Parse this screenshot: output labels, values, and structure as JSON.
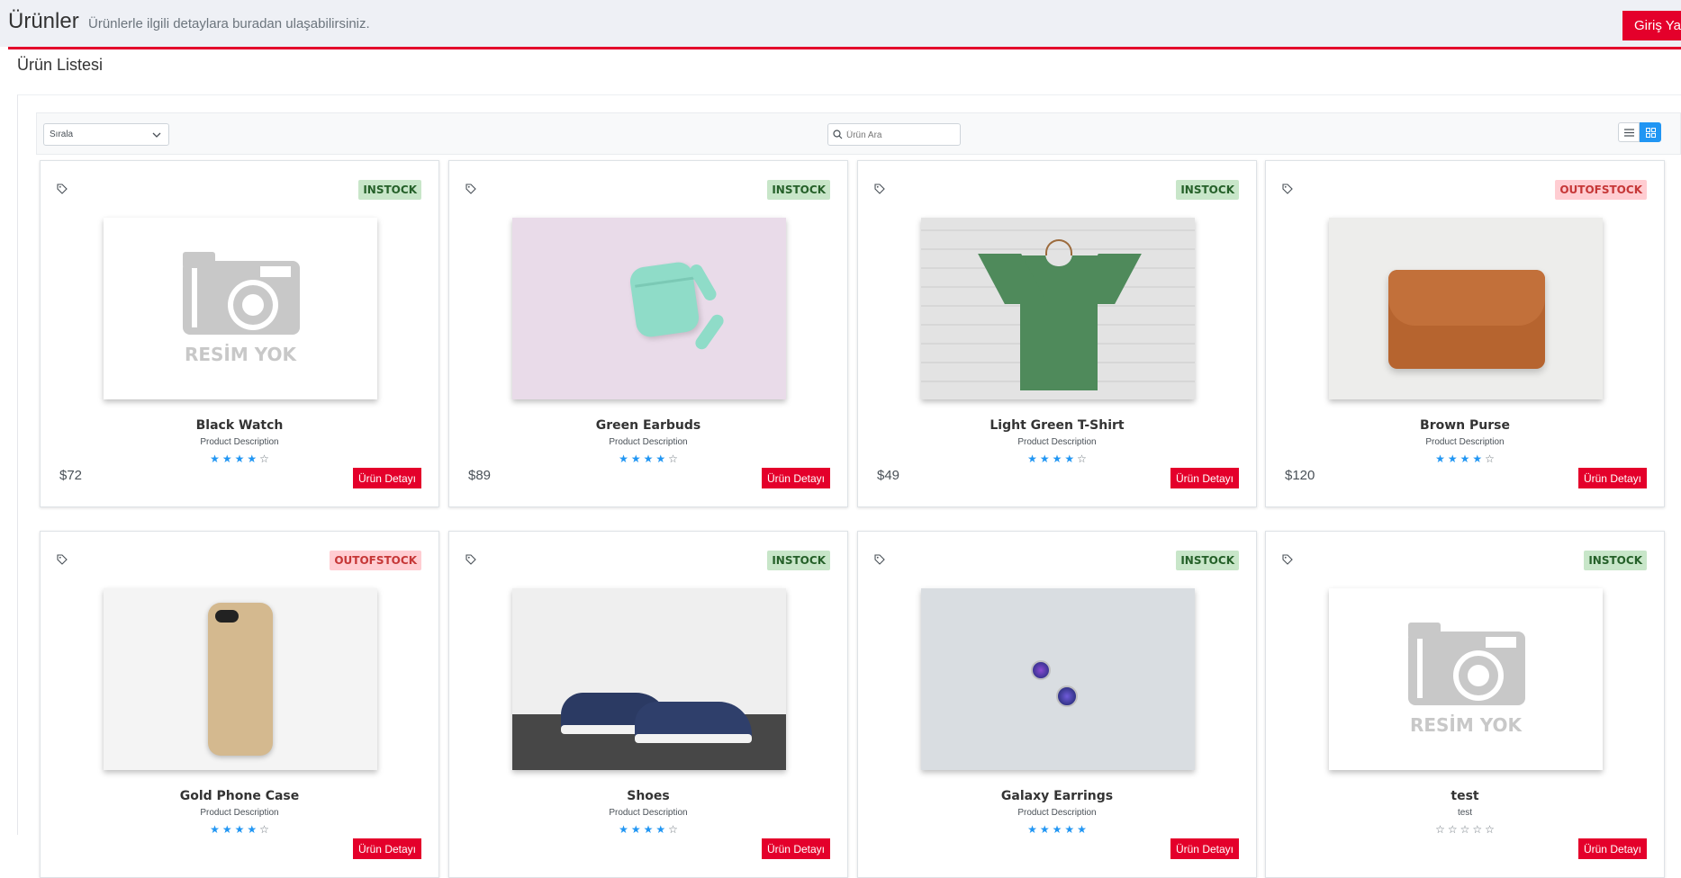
{
  "header": {
    "title": "Ürünler",
    "subtitle": "Ürünlerle ilgili detaylara buradan ulaşabilirsiniz.",
    "login_label": "Giriş Yap"
  },
  "section": {
    "title": "Ürün Listesi"
  },
  "toolbar": {
    "sort_label": "Sırala",
    "search_placeholder": "Ürün Ara"
  },
  "colors": {
    "accent": "#e4002b",
    "star": "#2196f3",
    "instock_bg": "#c8e6c9",
    "outofstock_bg": "#ffcdd2"
  },
  "products": [
    {
      "name": "Black Watch",
      "description": "Product Description",
      "price": "$72",
      "status": "INSTOCK",
      "rating": 4,
      "detail_label": "Ürün Detayı",
      "image": "no-image-placeholder",
      "no_image_text": "RESİM YOK"
    },
    {
      "name": "Green Earbuds",
      "description": "Product Description",
      "price": "$89",
      "status": "INSTOCK",
      "rating": 4,
      "detail_label": "Ürün Detayı",
      "image": "earbuds-photo"
    },
    {
      "name": "Light Green T-Shirt",
      "description": "Product Description",
      "price": "$49",
      "status": "INSTOCK",
      "rating": 4,
      "detail_label": "Ürün Detayı",
      "image": "tshirt-photo"
    },
    {
      "name": "Brown Purse",
      "description": "Product Description",
      "price": "$120",
      "status": "OUTOFSTOCK",
      "rating": 4,
      "detail_label": "Ürün Detayı",
      "image": "purse-photo"
    },
    {
      "name": "Gold Phone Case",
      "description": "Product Description",
      "price": "",
      "status": "OUTOFSTOCK",
      "rating": 4,
      "detail_label": "Ürün Detayı",
      "image": "phone-case-photo"
    },
    {
      "name": "Shoes",
      "description": "Product Description",
      "price": "",
      "status": "INSTOCK",
      "rating": 4,
      "detail_label": "Ürün Detayı",
      "image": "shoes-photo"
    },
    {
      "name": "Galaxy Earrings",
      "description": "Product Description",
      "price": "",
      "status": "INSTOCK",
      "rating": 5,
      "detail_label": "Ürün Detayı",
      "image": "earrings-photo"
    },
    {
      "name": "test",
      "description": "test",
      "price": "",
      "status": "INSTOCK",
      "rating": 0,
      "detail_label": "Ürün Detayı",
      "image": "no-image-placeholder",
      "no_image_text": "RESİM YOK"
    }
  ]
}
